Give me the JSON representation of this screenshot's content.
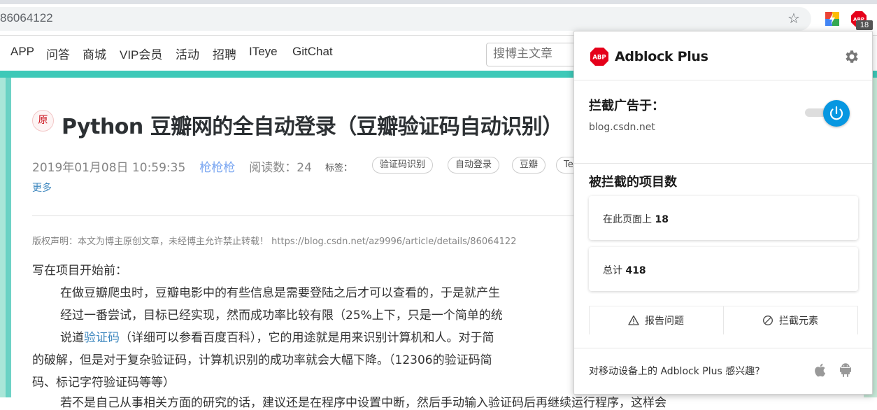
{
  "browser": {
    "url": "86064122",
    "badge_count": "18"
  },
  "nav": {
    "items": [
      "APP",
      "问答",
      "商城",
      "VIP会员",
      "活动",
      "招聘",
      "ITeye",
      "GitChat"
    ],
    "search_placeholder": "搜博主文章"
  },
  "article": {
    "original_badge": "原",
    "title": "Python 豆瓣网的全自动登录（豆瓣验证码自动识别）",
    "date": "2019年01月08日 10:59:35",
    "author": "枪枪枪",
    "reads": "阅读数：24",
    "tags_label": "标签：",
    "tags": [
      "验证码识别",
      "自动登录",
      "豆瓣",
      "Te"
    ],
    "more": "更多",
    "copyright": "版权声明：本文为博主原创文章，未经博主允许禁止转载！ https://blog.csdn.net/az9996/article/details/86064122",
    "p1": "写在项目开始前：",
    "p2": "在做豆瓣爬虫时，豆瓣电影中的有些信息是需要登陆之后才可以查看的，于是就产生",
    "p3": "经过一番尝试，目标已经实现，然而成功率比较有限（25%上下，只是一个简单的统",
    "p4a": "说道",
    "p4link": "验证码",
    "p4b": "（详细可以参看百度百科），它的用途就是用来识别计算机和人。对于简",
    "p5": "的破解，但是对于复杂验证码，计算机识别的成功率就会大幅下降。（12306的验证码简",
    "p6": "码、标记字符验证码等等）",
    "p7": "若不是自己从事相关方面的研究的话，建议还是在程序中设置中断，然后手动输入验证码后再继续运行程序，这样会"
  },
  "popup": {
    "title": "Adblock Plus",
    "block_label": "拦截广告于：",
    "domain": "blog.csdn.net",
    "count_label": "被拦截的项目数",
    "page_label": "在此页面上",
    "page_count": "18",
    "total_label": "总计",
    "total_count": "418",
    "report": "报告问题",
    "block_element": "拦截元素",
    "footer": "对移动设备上的 Adblock Plus 感兴趣?"
  },
  "colors": {
    "abp_red": "#e5001a",
    "toggle_blue": "#0797e1",
    "link_blue": "#3f88bf",
    "teal": "#3dc9b8"
  },
  "icons": [
    "star-icon",
    "extension-icon",
    "abp-icon",
    "gear-icon",
    "power-icon",
    "warning-icon",
    "block-icon",
    "apple-icon",
    "android-icon"
  ]
}
